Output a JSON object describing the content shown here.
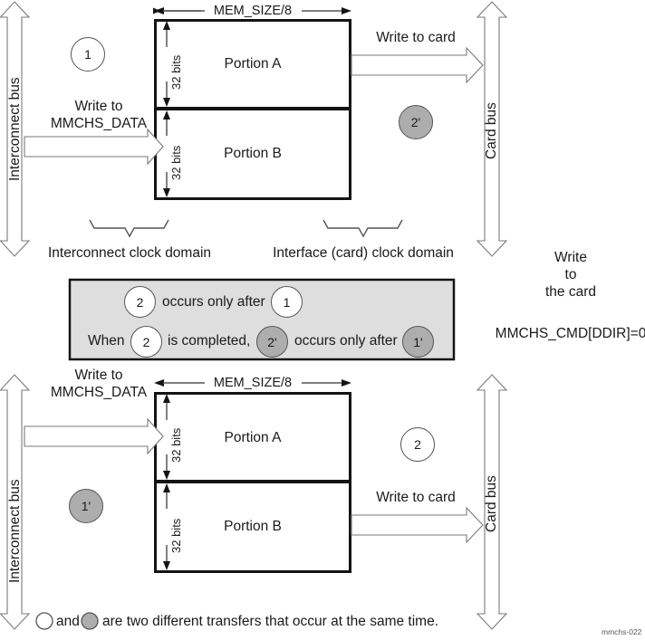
{
  "figure": {
    "id_label": "mmchs-022",
    "right_note_lines": [
      "Write",
      "to",
      "the card"
    ],
    "right_note_cmd": "MMCHS_CMD[DDIR]=0",
    "colors": {
      "outline": "#141414",
      "thin_line": "#555555",
      "gray_fill": "#adadad",
      "legend_fill": "#dedede",
      "white_fill": "#ffffff"
    }
  },
  "top_diagram": {
    "left_bus_label": "Interconnect bus",
    "right_bus_label": "Card bus",
    "width_label": "MEM_SIZE/8",
    "height_label_a": "32 bits",
    "height_label_b": "32 bits",
    "portion_a": "Portion A",
    "portion_b": "Portion B",
    "in_arrow_label_line1": "Write to",
    "in_arrow_label_line2": "MMCHS_DATA",
    "out_arrow_label": "Write to card",
    "marker_left": "1",
    "marker_right": "2'",
    "clock_domain_left": "Interconnect clock domain",
    "clock_domain_right": "Interface (card) clock domain"
  },
  "legend_box": {
    "line1_marker1": "2",
    "line1_text": "occurs only after",
    "line1_marker2": "1",
    "line2_prefix": "When",
    "line2_marker1": "2",
    "line2_mid": "is completed,",
    "line2_marker2": "2'",
    "line2_text": "occurs only after",
    "line2_marker3": "1'"
  },
  "bottom_diagram": {
    "left_bus_label": "Interconnect bus",
    "right_bus_label": "Card bus",
    "width_label": "MEM_SIZE/8",
    "height_label_a": "32 bits",
    "height_label_b": "32 bits",
    "portion_a": "Portion A",
    "portion_b": "Portion B",
    "in_arrow_label_line1": "Write to",
    "in_arrow_label_line2": "MMCHS_DATA",
    "out_arrow_label": "Write to card",
    "marker_left": "1'",
    "marker_right": "2"
  },
  "footer_legend": {
    "and_text": "and",
    "tail_text": "are two different transfers that occur at the same time."
  }
}
